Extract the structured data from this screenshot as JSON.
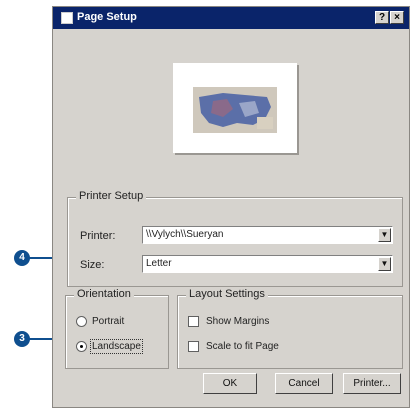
{
  "window": {
    "title": "Page Setup",
    "help_glyph": "?",
    "close_glyph": "×"
  },
  "printer_setup": {
    "group_label": "Printer Setup",
    "printer_label": "Printer:",
    "printer_value": "\\\\Vylych\\\\Sueryan",
    "size_label": "Size:",
    "size_value": "Letter"
  },
  "orientation": {
    "group_label": "Orientation",
    "options": [
      {
        "label": "Portrait",
        "selected": false
      },
      {
        "label": "Landscape",
        "selected": true
      }
    ]
  },
  "layout_settings": {
    "group_label": "Layout Settings",
    "options": [
      {
        "label": "Show Margins",
        "checked": false
      },
      {
        "label": "Scale to fit Page",
        "checked": false
      }
    ]
  },
  "buttons": {
    "ok": "OK",
    "cancel": "Cancel",
    "printer": "Printer..."
  },
  "callouts": {
    "size_callout": "4",
    "landscape_callout": "3"
  },
  "colors": {
    "titlebar": "#0a246a",
    "dialog": "#d6d3ce",
    "callout": "#0f4f8f"
  }
}
